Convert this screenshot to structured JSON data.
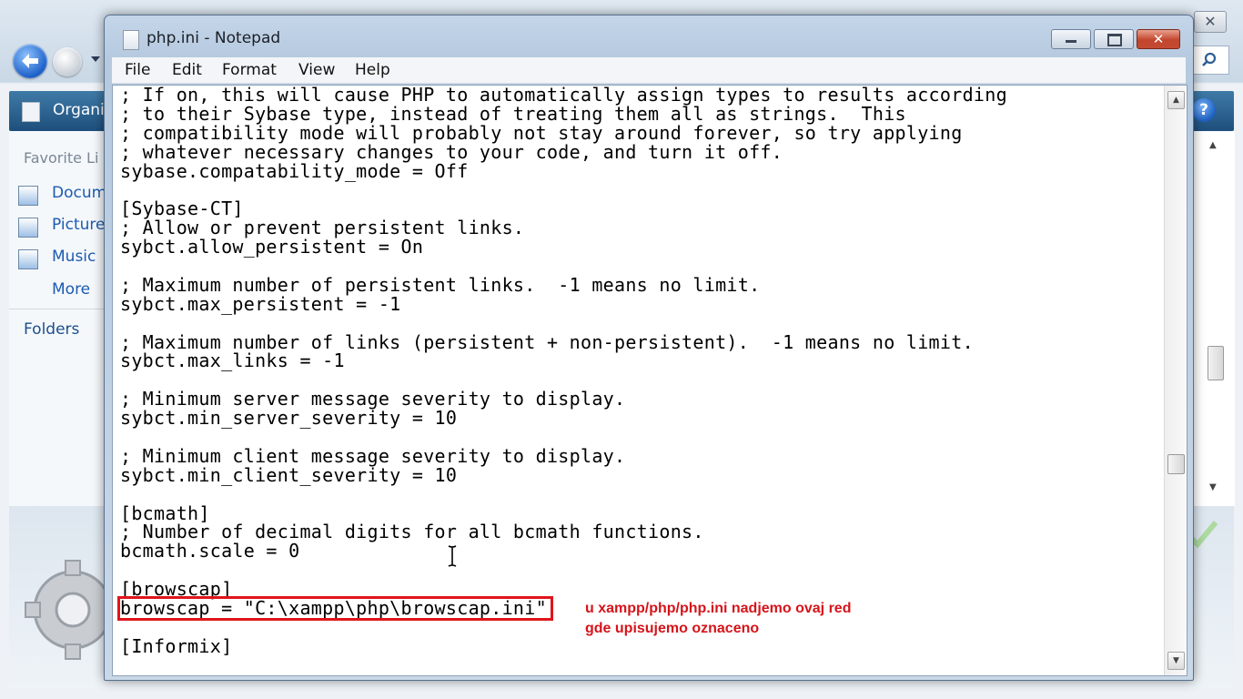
{
  "explorer": {
    "organize_label": "Organi",
    "favorites_title": "Favorite Li",
    "nav_items": [
      "Docum",
      "Picture",
      "Music",
      "More"
    ],
    "folders_label": "Folders",
    "close_glyph": "✕",
    "help_glyph": "?"
  },
  "notepad": {
    "title": "php.ini - Notepad",
    "menu": [
      "File",
      "Edit",
      "Format",
      "View",
      "Help"
    ],
    "lines": [
      "; If on, this will cause PHP to automatically assign types to results according",
      "; to their Sybase type, instead of treating them all as strings.  This",
      "; compatibility mode will probably not stay around forever, so try applying",
      "; whatever necessary changes to your code, and turn it off.",
      "sybase.compatability_mode = Off",
      "",
      "[Sybase-CT]",
      "; Allow or prevent persistent links.",
      "sybct.allow_persistent = On",
      "",
      "; Maximum number of persistent links.  -1 means no limit.",
      "sybct.max_persistent = -1",
      "",
      "; Maximum number of links (persistent + non-persistent).  -1 means no limit.",
      "sybct.max_links = -1",
      "",
      "; Minimum server message severity to display.",
      "sybct.min_server_severity = 10",
      "",
      "; Minimum client message severity to display.",
      "sybct.min_client_severity = 10",
      "",
      "[bcmath]",
      "; Number of decimal digits for all bcmath functions.",
      "bcmath.scale = 0",
      "",
      "[browscap]",
      "browscap = \"C:\\xampp\\php\\browscap.ini\"",
      "",
      "[Informix]"
    ],
    "highlighted_line_index": 27
  },
  "annotation": {
    "text": "u xampp/php/php.ini nadjemo ovaj red\ngde upisujemo oznaceno",
    "color": "#d5141a"
  },
  "icons": {
    "back": "back-arrow-icon",
    "forward": "forward-icon",
    "search": "search-icon",
    "help": "help-icon",
    "gear": "gear-icon",
    "notepad": "notepad-icon"
  }
}
